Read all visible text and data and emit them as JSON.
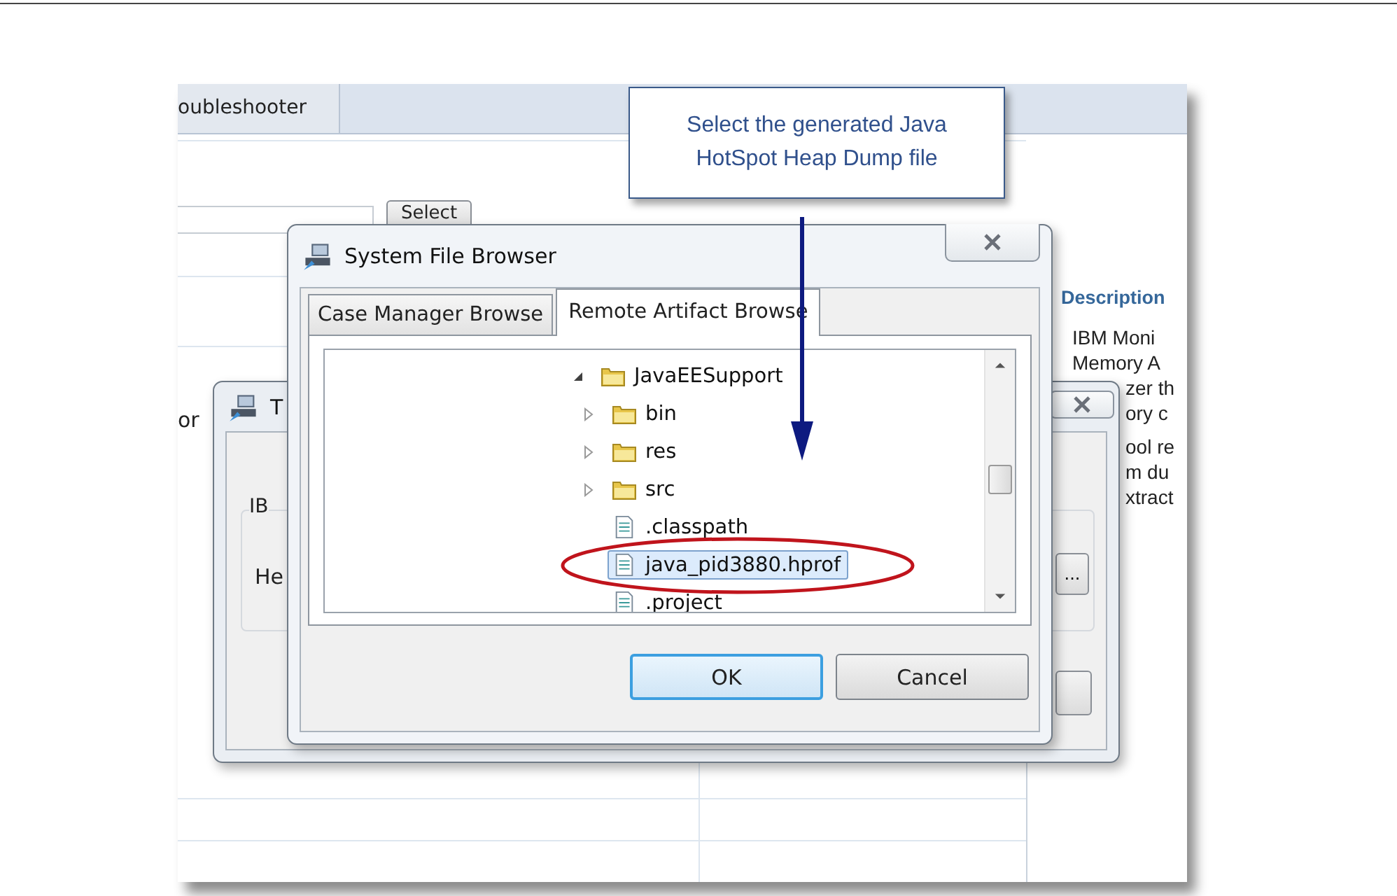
{
  "app": {
    "tab": "oubleshooter",
    "select_button": "Select",
    "side_label": "or",
    "description": {
      "title": "Description",
      "lines": [
        "IBM Moni",
        "Memory A",
        "zer th",
        "ory c",
        "ool re",
        "m du",
        "xtract"
      ]
    }
  },
  "back_dialog": {
    "title": "T",
    "group_label": "IB",
    "field_label": "He",
    "browse_button": "..."
  },
  "file_browser": {
    "title": "System File Browser",
    "tabs": [
      {
        "label": "Case Manager Browse",
        "selected": false
      },
      {
        "label": "Remote Artifact Browse",
        "selected": true
      }
    ],
    "tree": [
      {
        "label": "JavaEESupport",
        "kind": "folder",
        "expanded": true,
        "selected": false,
        "children": [
          {
            "label": "bin",
            "kind": "folder",
            "expanded": false,
            "selected": false
          },
          {
            "label": "res",
            "kind": "folder",
            "expanded": false,
            "selected": false
          },
          {
            "label": "src",
            "kind": "folder",
            "expanded": false,
            "selected": false
          },
          {
            "label": ".classpath",
            "kind": "file",
            "selected": false
          },
          {
            "label": "java_pid3880.hprof",
            "kind": "file",
            "selected": true
          },
          {
            "label": ".project",
            "kind": "file",
            "selected": false
          }
        ]
      }
    ],
    "buttons": [
      {
        "label": "OK",
        "default": true
      },
      {
        "label": "Cancel",
        "default": false
      }
    ]
  },
  "callout": {
    "text": "Select the generated Java HotSpot Heap Dump file"
  }
}
